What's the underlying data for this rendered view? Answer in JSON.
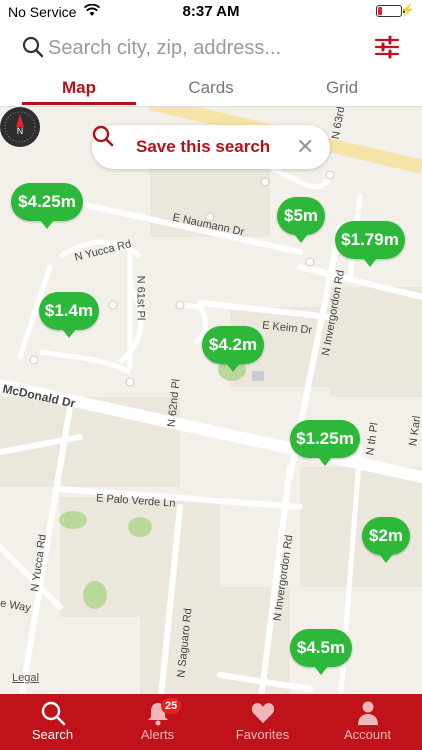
{
  "status": {
    "carrier": "No Service",
    "time": "8:37 AM"
  },
  "search": {
    "placeholder": "Search city, zip, address..."
  },
  "tabs": {
    "map": "Map",
    "cards": "Cards",
    "grid": "Grid"
  },
  "map": {
    "save_search_label": "Save this search",
    "legal": "Legal",
    "pins": [
      {
        "label": "$4.25m"
      },
      {
        "label": "$5m"
      },
      {
        "label": "$1.79m"
      },
      {
        "label": "$1.4m"
      },
      {
        "label": "$4.2m"
      },
      {
        "label": "$1.25m"
      },
      {
        "label": "$2m"
      },
      {
        "label": "$4.5m"
      }
    ],
    "streets": {
      "naumann": "E Naumann Dr",
      "yucca_rd": "N Yucca Rd",
      "sixty_first": "N 61st Pl",
      "keim": "E Keim Dr",
      "mcdonald": "McDonald Dr",
      "sixty_second": "N 62nd Pl",
      "invergordon": "N Invergordon Rd",
      "invergordon_2": "N Invergordon Rd",
      "palo_verde": "E Palo Verde Ln",
      "yucca_rd_2": "N Yucca Rd",
      "saguaro": "N Saguaro Rd",
      "way": "e Way",
      "sixty_third": "N 63rd",
      "nth_pl": "N th Pl",
      "karl": "N Karl"
    }
  },
  "bottom_nav": {
    "search": "Search",
    "alerts": "Alerts",
    "alerts_badge": "25",
    "favorites": "Favorites",
    "account": "Account"
  },
  "colors": {
    "brand_red": "#c0121b",
    "pin_green": "#2eb83a"
  }
}
